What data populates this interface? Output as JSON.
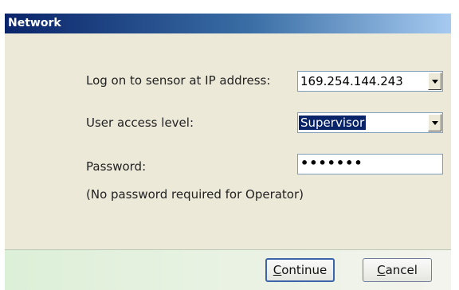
{
  "window": {
    "title": "Network"
  },
  "form": {
    "ip_label": "Log on to sensor at IP address:",
    "ip_value": "169.254.144.243",
    "access_label": "User access level:",
    "access_value": "Supervisor",
    "password_label": "Password:",
    "password_value": "•••••••",
    "note": "(No password required for Operator)"
  },
  "buttons": {
    "continue_first": "C",
    "continue_rest": "ontinue",
    "cancel_first": "C",
    "cancel_rest": "ancel"
  },
  "icons": {
    "dropdown": "chevron-down-icon"
  }
}
